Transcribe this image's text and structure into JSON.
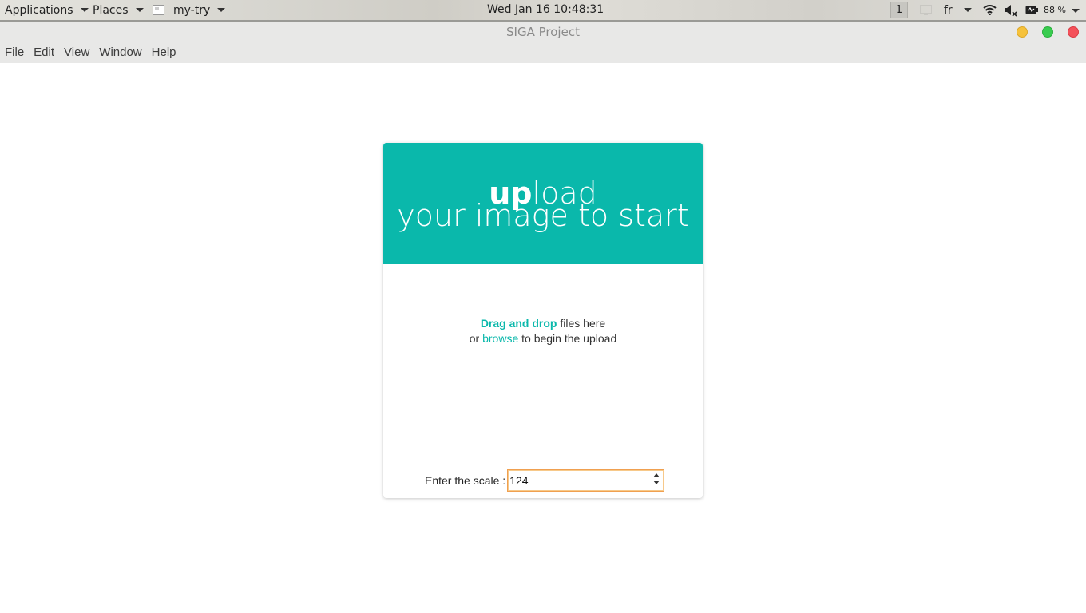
{
  "panel": {
    "applications_label": "Applications",
    "places_label": "Places",
    "app_label": "my-try",
    "clock": "Wed Jan 16  10:48:31",
    "workspace": "1",
    "keyboard_layout": "fr",
    "battery_percent": "88 %"
  },
  "window": {
    "title": "SIGA Project"
  },
  "menubar": {
    "items": [
      "File",
      "Edit",
      "View",
      "Window",
      "Help"
    ]
  },
  "upload": {
    "heading_bold": "up",
    "heading_light": "load",
    "heading_line2": "your image to start",
    "drag_drop": "Drag and drop",
    "files_here": " files here",
    "or_text": "or ",
    "browse": "browse",
    "begin_text": " to begin the upload",
    "scale_label": "Enter the scale :",
    "scale_value": "124"
  },
  "colors": {
    "accent": "#0ab8ab",
    "minimize": "#f6c23c",
    "maximize": "#38cc4f",
    "close": "#f4515a",
    "input_focus": "#f0a050"
  }
}
